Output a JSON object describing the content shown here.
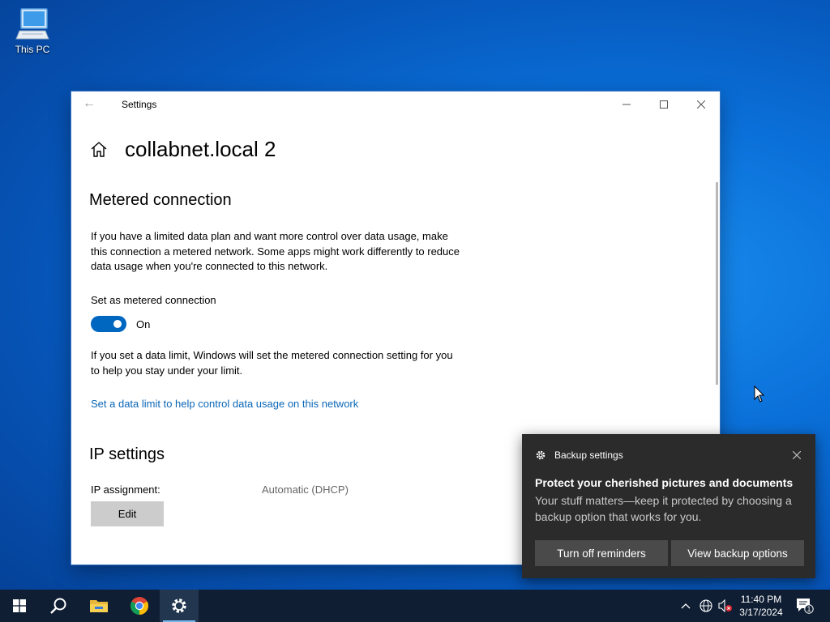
{
  "desktop": {
    "icons": [
      {
        "label": "This PC",
        "icon": "computer-icon"
      }
    ]
  },
  "window": {
    "title": "Settings",
    "page_title": "collabnet.local 2",
    "metered": {
      "heading": "Metered connection",
      "description": "If you have a limited data plan and want more control over data usage, make this connection a metered network. Some apps might work differently to reduce data usage when you're connected to this network.",
      "toggle_label": "Set as metered connection",
      "toggle_state": "On",
      "toggle_on": true,
      "limit_note": "If you set a data limit, Windows will set the metered connection setting for you to help you stay under your limit.",
      "limit_link": "Set a data limit to help control data usage on this network"
    },
    "ip": {
      "heading": "IP settings",
      "assignment_label": "IP assignment:",
      "assignment_value": "Automatic (DHCP)",
      "edit_label": "Edit"
    }
  },
  "toast": {
    "app": "Backup settings",
    "title": "Protect your cherished pictures and documents",
    "body": "Your stuff matters—keep it protected by choosing a backup option that works for you.",
    "buttons": [
      "Turn off reminders",
      "View backup options"
    ]
  },
  "taskbar": {
    "apps": [
      "start-icon",
      "search-icon",
      "file-explorer-icon",
      "chrome-icon",
      "settings-icon"
    ],
    "time": "11:40 PM",
    "date": "3/17/2024",
    "notification_count": "1"
  },
  "colors": {
    "accent": "#0067c0",
    "link": "#0b67b8",
    "taskbar": "#0f1e33",
    "toast_bg": "#2b2b2b"
  }
}
